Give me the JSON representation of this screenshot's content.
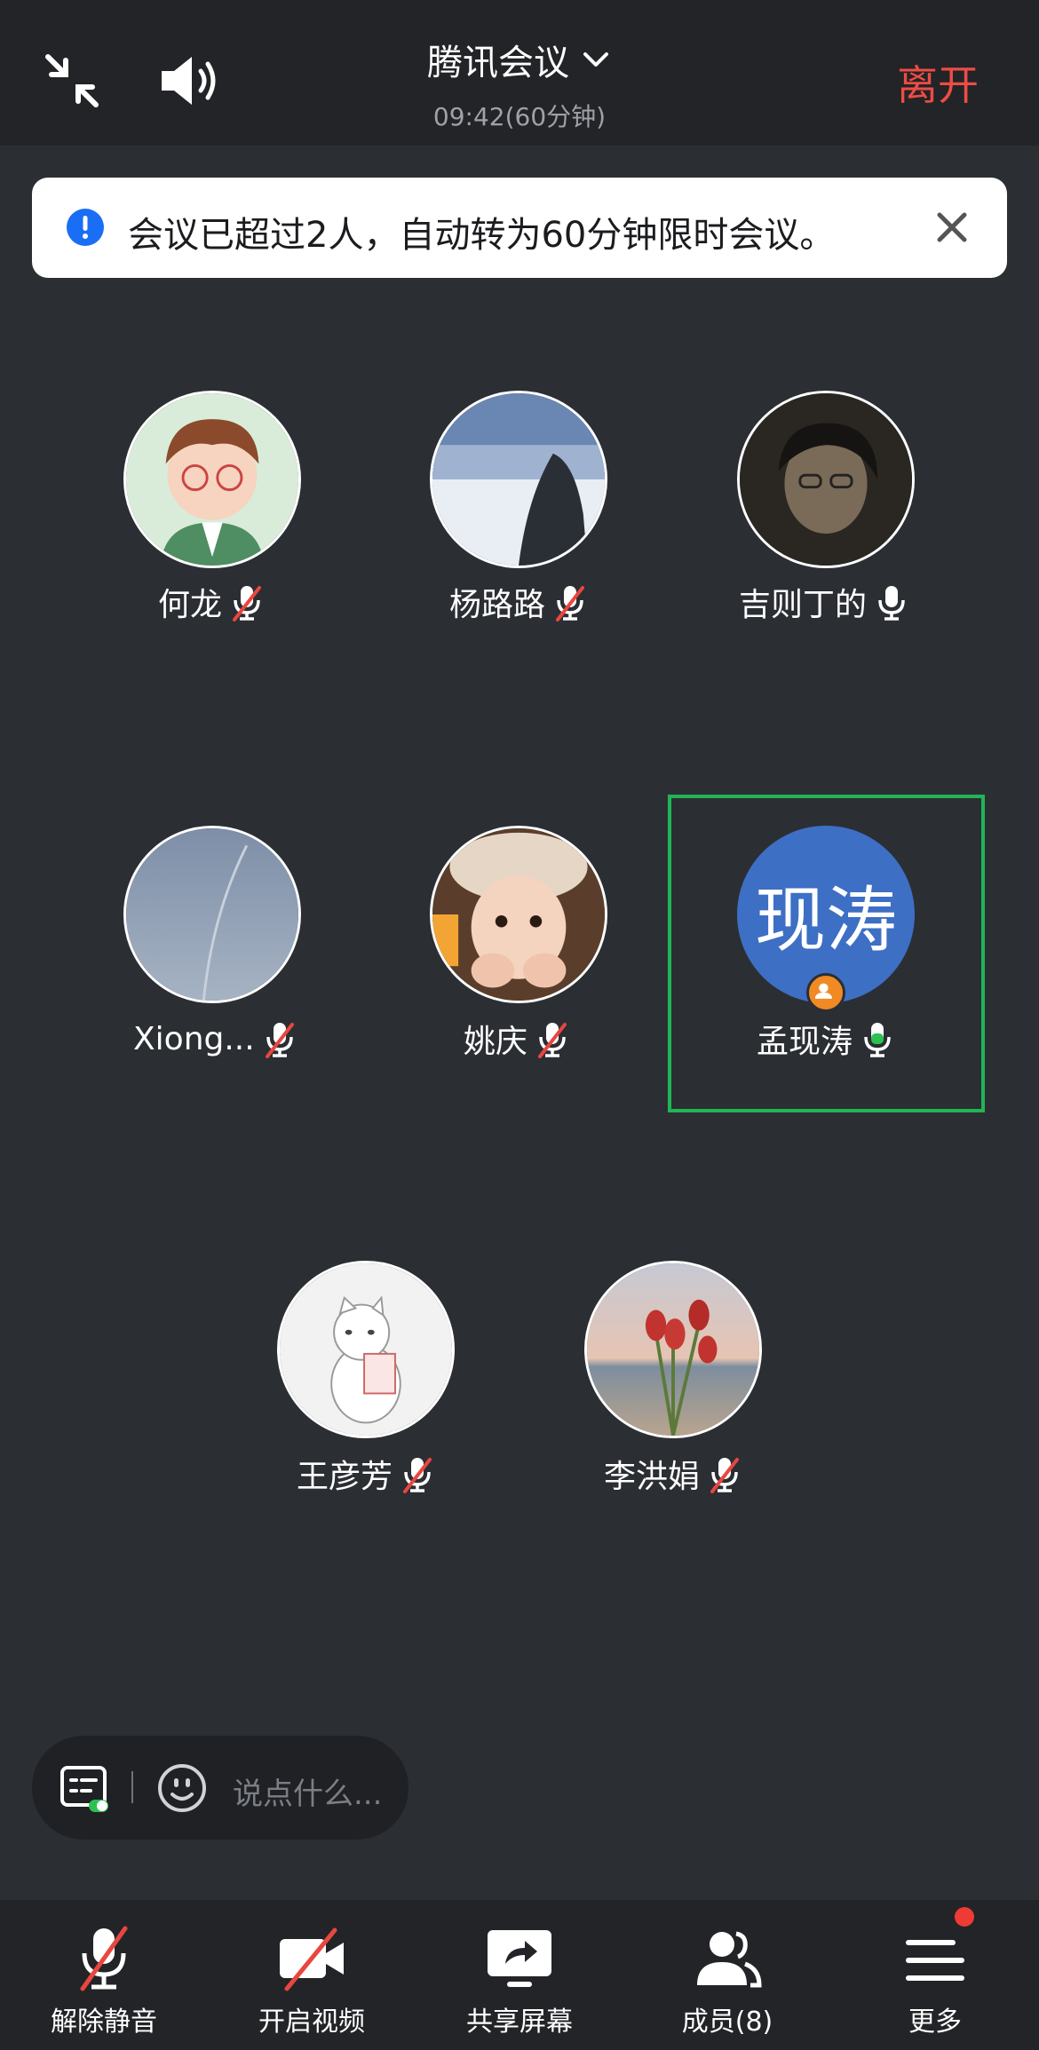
{
  "header": {
    "title": "腾讯会议",
    "time": "09:42(60分钟)",
    "leave_label": "离开"
  },
  "banner": {
    "message": "会议已超过2人，自动转为60分钟限时会议。"
  },
  "participants": [
    {
      "name": "何龙",
      "muted": true
    },
    {
      "name": "杨路路",
      "muted": true
    },
    {
      "name": "吉则丁的",
      "muted": false
    },
    {
      "name": "Xiong...",
      "muted": true
    },
    {
      "name": "姚庆",
      "muted": true
    },
    {
      "name": "孟现涛",
      "muted": false,
      "avatar_text": "现涛",
      "speaking": true,
      "host": true
    },
    {
      "name": "王彦芳",
      "muted": true
    },
    {
      "name": "李洪娟",
      "muted": true
    }
  ],
  "chat": {
    "placeholder": "说点什么..."
  },
  "toolbar": {
    "unmute_label": "解除静音",
    "video_label": "开启视频",
    "share_label": "共享屏幕",
    "members_label": "成员(8)",
    "more_label": "更多"
  },
  "colors": {
    "background": "#2b2e33",
    "leave": "#ee4c45",
    "active_frame": "#20b655",
    "text_avatar": "#3d6fc4",
    "mute_slash": "#e8463f"
  }
}
